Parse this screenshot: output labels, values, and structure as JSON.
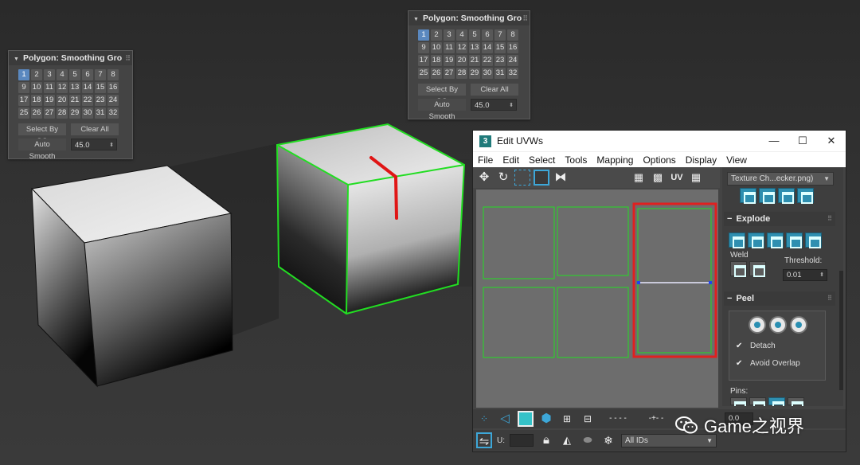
{
  "sg_panel_left": {
    "title": "Polygon: Smoothing Gro",
    "groups": [
      "1",
      "2",
      "3",
      "4",
      "5",
      "6",
      "7",
      "8",
      "9",
      "10",
      "11",
      "12",
      "13",
      "14",
      "15",
      "16",
      "17",
      "18",
      "19",
      "20",
      "21",
      "22",
      "23",
      "24",
      "25",
      "26",
      "27",
      "28",
      "29",
      "30",
      "31",
      "32"
    ],
    "active_group": "1",
    "select_by_sg": "Select By SG",
    "clear_all": "Clear All",
    "auto_smooth": "Auto Smooth",
    "auto_smooth_value": "45.0"
  },
  "sg_panel_top": {
    "title": "Polygon: Smoothing Gro",
    "groups": [
      "1",
      "2",
      "3",
      "4",
      "5",
      "6",
      "7",
      "8",
      "9",
      "10",
      "11",
      "12",
      "13",
      "14",
      "15",
      "16",
      "17",
      "18",
      "19",
      "20",
      "21",
      "22",
      "23",
      "24",
      "25",
      "26",
      "27",
      "28",
      "29",
      "30",
      "31",
      "32"
    ],
    "active_group": "1",
    "select_by_sg": "Select By SG",
    "clear_all": "Clear All",
    "auto_smooth": "Auto Smooth",
    "auto_smooth_value": "45.0"
  },
  "uvw_window": {
    "app_icon": "3",
    "title": "Edit UVWs",
    "window_buttons": [
      "—",
      "☐",
      "✕"
    ],
    "menu": [
      "File",
      "Edit",
      "Select",
      "Tools",
      "Mapping",
      "Options",
      "Display",
      "View"
    ],
    "toolbar_uv_label": "UV",
    "texture_dropdown": "Texture Ch...ecker.png)",
    "explode": {
      "title": "Explode",
      "weld_label": "Weld",
      "threshold_label": "Threshold:",
      "threshold_value": "0.01"
    },
    "peel": {
      "title": "Peel",
      "detach_label": "Detach",
      "avoid_overlap_label": "Avoid Overlap",
      "pins_label": "Pins:"
    },
    "bottom": {
      "spinner_value": "0.0",
      "u_label": "U:",
      "ids_dropdown": "All IDs"
    }
  },
  "watermark": {
    "text": "Game之视界"
  },
  "colors": {
    "selection_green": "#22dd22",
    "selection_red": "#e02020",
    "accent_blue": "#5a88bf",
    "tool_teal": "#2e8fb0"
  }
}
